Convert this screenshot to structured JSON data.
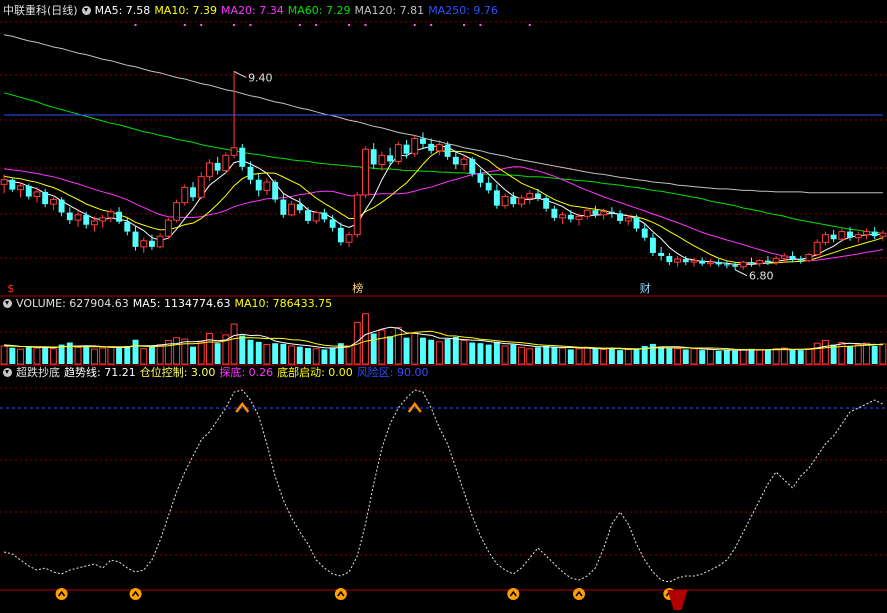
{
  "colors": {
    "up": "#ff3c3c",
    "down": "#54ffff",
    "grid": "#8b0000",
    "axis": "#b00000",
    "ma5": "#ffffff",
    "ma10": "#ffff00",
    "ma20": "#ff33ff",
    "ma60": "#00e000",
    "ma120": "#c0c0c0",
    "ma250": "#3050ff",
    "trend": "#e8e8e8",
    "pos": "#ffff66",
    "probe": "#ff33ff",
    "start": "#ffff00",
    "risk": "#3050ff",
    "signal": "#ffa000",
    "sell": "#ff8c00",
    "bottom_marker": "#b00000"
  },
  "header_main": {
    "title": "中联重科(日线)",
    "ma5": "MA5: 7.58",
    "ma10": "MA10: 7.39",
    "ma20": "MA20: 7.34",
    "ma60": "MA60: 7.29",
    "ma120": "MA120: 7.81",
    "ma250": "MA250: 9.76"
  },
  "header_volume": {
    "title": "VOLUME: 627904.63",
    "ma5": "MA5: 1134774.63",
    "ma10": "MA10: 786433.75"
  },
  "header_indicator": {
    "title": "超跌抄底",
    "trend": "趋势线: 71.21",
    "pos": "仓位控制: 3.00",
    "probe": "探底: 0.26",
    "start": "底部启动: 0.00",
    "risk": "风险区: 90.00"
  },
  "chart_data": {
    "type": "candlestick",
    "price": {
      "ohlc": [
        [
          7.92,
          8.05,
          7.8,
          7.98
        ],
        [
          7.98,
          8.0,
          7.82,
          7.85
        ],
        [
          7.85,
          7.95,
          7.75,
          7.9
        ],
        [
          7.9,
          7.93,
          7.72,
          7.76
        ],
        [
          7.76,
          7.88,
          7.68,
          7.82
        ],
        [
          7.82,
          7.86,
          7.62,
          7.66
        ],
        [
          7.66,
          7.78,
          7.58,
          7.72
        ],
        [
          7.72,
          7.75,
          7.5,
          7.55
        ],
        [
          7.55,
          7.62,
          7.4,
          7.45
        ],
        [
          7.45,
          7.58,
          7.36,
          7.52
        ],
        [
          7.52,
          7.56,
          7.34,
          7.39
        ],
        [
          7.39,
          7.5,
          7.3,
          7.44
        ],
        [
          7.44,
          7.52,
          7.35,
          7.48
        ],
        [
          7.48,
          7.6,
          7.42,
          7.56
        ],
        [
          7.56,
          7.62,
          7.4,
          7.43
        ],
        [
          7.43,
          7.48,
          7.25,
          7.3
        ],
        [
          7.3,
          7.38,
          7.05,
          7.1
        ],
        [
          7.1,
          7.22,
          7.02,
          7.18
        ],
        [
          7.18,
          7.26,
          7.06,
          7.1
        ],
        [
          7.1,
          7.28,
          7.08,
          7.24
        ],
        [
          7.24,
          7.48,
          7.2,
          7.45
        ],
        [
          7.45,
          7.72,
          7.42,
          7.68
        ],
        [
          7.68,
          7.92,
          7.64,
          7.88
        ],
        [
          7.88,
          7.95,
          7.7,
          7.75
        ],
        [
          7.75,
          8.08,
          7.72,
          8.02
        ],
        [
          8.02,
          8.25,
          7.96,
          8.2
        ],
        [
          8.2,
          8.28,
          8.05,
          8.1
        ],
        [
          8.1,
          8.34,
          8.06,
          8.3
        ],
        [
          8.3,
          9.4,
          8.26,
          8.4
        ],
        [
          8.4,
          8.45,
          8.1,
          8.15
        ],
        [
          8.15,
          8.22,
          7.92,
          7.98
        ],
        [
          7.98,
          8.06,
          7.76,
          7.84
        ],
        [
          7.84,
          8.0,
          7.78,
          7.95
        ],
        [
          7.95,
          7.98,
          7.68,
          7.72
        ],
        [
          7.72,
          7.8,
          7.48,
          7.52
        ],
        [
          7.52,
          7.7,
          7.5,
          7.66
        ],
        [
          7.66,
          7.74,
          7.54,
          7.58
        ],
        [
          7.58,
          7.62,
          7.4,
          7.44
        ],
        [
          7.44,
          7.58,
          7.4,
          7.55
        ],
        [
          7.55,
          7.6,
          7.42,
          7.46
        ],
        [
          7.46,
          7.52,
          7.3,
          7.35
        ],
        [
          7.35,
          7.42,
          7.12,
          7.16
        ],
        [
          7.16,
          7.3,
          7.1,
          7.26
        ],
        [
          7.26,
          7.82,
          7.22,
          7.78
        ],
        [
          7.78,
          8.42,
          7.74,
          8.38
        ],
        [
          8.38,
          8.46,
          8.12,
          8.18
        ],
        [
          8.18,
          8.35,
          8.1,
          8.3
        ],
        [
          8.3,
          8.4,
          8.16,
          8.22
        ],
        [
          8.22,
          8.48,
          8.18,
          8.44
        ],
        [
          8.44,
          8.5,
          8.26,
          8.32
        ],
        [
          8.32,
          8.56,
          8.28,
          8.52
        ],
        [
          8.52,
          8.6,
          8.38,
          8.45
        ],
        [
          8.45,
          8.52,
          8.32,
          8.36
        ],
        [
          8.36,
          8.5,
          8.3,
          8.44
        ],
        [
          8.44,
          8.48,
          8.24,
          8.28
        ],
        [
          8.28,
          8.36,
          8.12,
          8.18
        ],
        [
          8.18,
          8.3,
          8.1,
          8.25
        ],
        [
          8.25,
          8.28,
          8.02,
          8.06
        ],
        [
          8.06,
          8.12,
          7.88,
          7.94
        ],
        [
          7.94,
          8.02,
          7.8,
          7.84
        ],
        [
          7.84,
          7.92,
          7.6,
          7.64
        ],
        [
          7.64,
          7.8,
          7.6,
          7.76
        ],
        [
          7.76,
          7.82,
          7.62,
          7.66
        ],
        [
          7.66,
          7.78,
          7.62,
          7.74
        ],
        [
          7.74,
          7.84,
          7.66,
          7.8
        ],
        [
          7.8,
          7.86,
          7.7,
          7.74
        ],
        [
          7.74,
          7.78,
          7.56,
          7.6
        ],
        [
          7.6,
          7.64,
          7.44,
          7.48
        ],
        [
          7.48,
          7.56,
          7.4,
          7.52
        ],
        [
          7.52,
          7.58,
          7.42,
          7.46
        ],
        [
          7.46,
          7.54,
          7.38,
          7.5
        ],
        [
          7.5,
          7.62,
          7.46,
          7.58
        ],
        [
          7.58,
          7.64,
          7.48,
          7.52
        ],
        [
          7.52,
          7.6,
          7.46,
          7.56
        ],
        [
          7.56,
          7.62,
          7.48,
          7.54
        ],
        [
          7.54,
          7.58,
          7.4,
          7.44
        ],
        [
          7.44,
          7.52,
          7.38,
          7.48
        ],
        [
          7.48,
          7.52,
          7.3,
          7.34
        ],
        [
          7.34,
          7.4,
          7.18,
          7.22
        ],
        [
          7.22,
          7.28,
          6.98,
          7.02
        ],
        [
          7.02,
          7.1,
          6.92,
          6.98
        ],
        [
          6.98,
          7.02,
          6.86,
          6.9
        ],
        [
          6.9,
          6.98,
          6.84,
          6.94
        ],
        [
          6.94,
          6.98,
          6.86,
          6.9
        ],
        [
          6.9,
          6.96,
          6.84,
          6.92
        ],
        [
          6.92,
          6.96,
          6.85,
          6.88
        ],
        [
          6.88,
          6.94,
          6.84,
          6.9
        ],
        [
          6.9,
          6.94,
          6.84,
          6.87
        ],
        [
          6.87,
          6.92,
          6.82,
          6.86
        ],
        [
          6.86,
          6.9,
          6.8,
          6.84
        ],
        [
          6.84,
          6.92,
          6.8,
          6.9
        ],
        [
          6.9,
          6.96,
          6.84,
          6.88
        ],
        [
          6.88,
          6.94,
          6.84,
          6.92
        ],
        [
          6.92,
          6.98,
          6.86,
          6.9
        ],
        [
          6.9,
          6.98,
          6.86,
          6.95
        ],
        [
          6.95,
          7.02,
          6.9,
          6.98
        ],
        [
          6.98,
          7.04,
          6.9,
          6.94
        ],
        [
          6.94,
          6.98,
          6.88,
          6.92
        ],
        [
          6.92,
          7.02,
          6.9,
          7.0
        ],
        [
          7.0,
          7.2,
          6.98,
          7.16
        ],
        [
          7.16,
          7.3,
          7.12,
          7.26
        ],
        [
          7.26,
          7.32,
          7.16,
          7.2
        ],
        [
          7.2,
          7.34,
          7.16,
          7.3
        ],
        [
          7.3,
          7.36,
          7.18,
          7.22
        ],
        [
          7.22,
          7.3,
          7.16,
          7.26
        ],
        [
          7.26,
          7.34,
          7.2,
          7.3
        ],
        [
          7.3,
          7.36,
          7.2,
          7.24
        ],
        [
          7.24,
          7.32,
          7.18,
          7.28
        ]
      ],
      "high_label": "9.40",
      "low_label": "6.80",
      "marks": [
        {
          "index": 1,
          "text": "$"
        },
        {
          "index": 43,
          "text": "榜"
        },
        {
          "index": 78,
          "text": "财"
        }
      ],
      "ma120": [
        9.88,
        9.86,
        9.83,
        9.8,
        9.78,
        9.75,
        9.72,
        9.7,
        9.67,
        9.64,
        9.62,
        9.59,
        9.56,
        9.54,
        9.51,
        9.48,
        9.46,
        9.43,
        9.4,
        9.38,
        9.35,
        9.32,
        9.3,
        9.27,
        9.24,
        9.22,
        9.19,
        9.16,
        9.14,
        9.11,
        9.08,
        9.06,
        9.03,
        9.0,
        8.98,
        8.95,
        8.92,
        8.9,
        8.87,
        8.84,
        8.82,
        8.79,
        8.76,
        8.74,
        8.71,
        8.68,
        8.66,
        8.63,
        8.6,
        8.58,
        8.56,
        8.53,
        8.5,
        8.48,
        8.45,
        8.43,
        8.4,
        8.38,
        8.36,
        8.33,
        8.31,
        8.29,
        8.26,
        8.24,
        8.22,
        8.2,
        8.18,
        8.16,
        8.14,
        8.12,
        8.1,
        8.08,
        8.06,
        8.05,
        8.03,
        8.01,
        8.0,
        7.98,
        7.97,
        7.95,
        7.94,
        7.93,
        7.91,
        7.9,
        7.89,
        7.88,
        7.87,
        7.86,
        7.86,
        7.85,
        7.84,
        7.84,
        7.83,
        7.83,
        7.82,
        7.82,
        7.82,
        7.82,
        7.81,
        7.81,
        7.81,
        7.81,
        7.81,
        7.81,
        7.81,
        7.81,
        7.81,
        7.81
      ],
      "ma60": [
        9.12,
        9.09,
        9.06,
        9.03,
        9.0,
        8.96,
        8.93,
        8.9,
        8.87,
        8.84,
        8.81,
        8.78,
        8.75,
        8.72,
        8.7,
        8.67,
        8.64,
        8.61,
        8.59,
        8.56,
        8.54,
        8.51,
        8.49,
        8.47,
        8.44,
        8.42,
        8.4,
        8.38,
        8.36,
        8.34,
        8.32,
        8.31,
        8.29,
        8.27,
        8.26,
        8.24,
        8.23,
        8.22,
        8.2,
        8.19,
        8.18,
        8.17,
        8.16,
        8.15,
        8.14,
        8.13,
        8.12,
        8.12,
        8.11,
        8.1,
        8.1,
        8.09,
        8.09,
        8.08,
        8.08,
        8.07,
        8.07,
        8.06,
        8.06,
        8.05,
        8.05,
        8.04,
        8.04,
        8.03,
        8.02,
        8.02,
        8.01,
        8.0,
        7.99,
        7.98,
        7.97,
        7.96,
        7.95,
        7.93,
        7.92,
        7.91,
        7.89,
        7.88,
        7.86,
        7.84,
        7.83,
        7.81,
        7.79,
        7.77,
        7.75,
        7.73,
        7.7,
        7.68,
        7.66,
        7.64,
        7.61,
        7.59,
        7.57,
        7.54,
        7.52,
        7.5,
        7.47,
        7.45,
        7.43,
        7.41,
        7.39,
        7.37,
        7.35,
        7.33,
        7.32,
        7.3,
        7.29,
        7.28
      ],
      "ma250": [
        9.76
      ],
      "ma20": [
        8.05
      ],
      "ma10": [
        7.39
      ],
      "ma5": [
        7.58
      ]
    },
    "volume": {
      "values": [
        520,
        470,
        430,
        520,
        460,
        500,
        440,
        560,
        620,
        480,
        520,
        430,
        460,
        500,
        470,
        520,
        700,
        440,
        500,
        560,
        680,
        760,
        720,
        500,
        640,
        880,
        600,
        840,
        1150,
        820,
        700,
        640,
        560,
        600,
        580,
        520,
        500,
        460,
        440,
        420,
        480,
        600,
        520,
        1200,
        1450,
        880,
        980,
        800,
        1050,
        760,
        880,
        760,
        700,
        640,
        720,
        780,
        680,
        620,
        600,
        560,
        640,
        520,
        560,
        480,
        440,
        480,
        520,
        500,
        460,
        420,
        440,
        480,
        440,
        420,
        460,
        400,
        420,
        440,
        520,
        580,
        500,
        460,
        440,
        420,
        440,
        400,
        420,
        380,
        400,
        380,
        420,
        440,
        400,
        420,
        440,
        460,
        420,
        400,
        440,
        600,
        680,
        560,
        620,
        520,
        560,
        600,
        520,
        580
      ],
      "ma5": [
        560
      ],
      "ma10": [
        520
      ]
    },
    "indicator": {
      "trend": [
        18,
        17,
        14,
        11,
        9,
        10,
        8,
        7,
        9,
        10,
        11,
        12,
        10,
        14,
        13,
        10,
        8,
        9,
        14,
        24,
        36,
        48,
        58,
        66,
        74,
        78,
        84,
        90,
        98,
        99,
        94,
        86,
        72,
        56,
        44,
        35,
        28,
        22,
        14,
        10,
        7,
        6,
        8,
        16,
        32,
        52,
        70,
        82,
        90,
        95,
        99,
        98,
        90,
        80,
        72,
        60,
        48,
        36,
        26,
        18,
        12,
        9,
        7,
        10,
        15,
        20,
        16,
        12,
        8,
        5,
        4,
        6,
        10,
        20,
        32,
        38,
        32,
        22,
        14,
        8,
        4,
        3,
        5,
        6,
        6,
        7,
        9,
        11,
        14,
        20,
        28,
        36,
        44,
        52,
        58,
        54,
        50,
        56,
        60,
        66,
        72,
        76,
        82,
        88,
        90,
        92,
        94,
        92
      ]
    }
  }
}
